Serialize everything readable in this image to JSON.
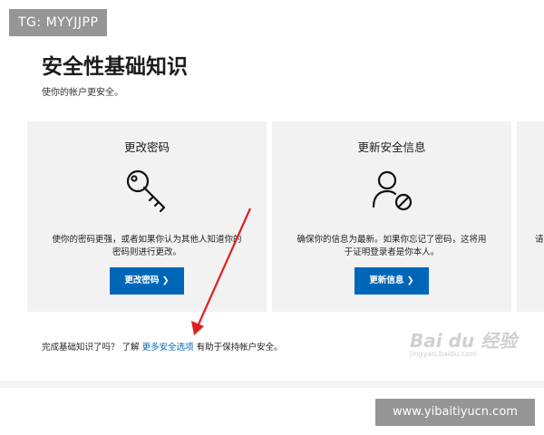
{
  "overlay": {
    "tg_label": "TG: MYYJJPP",
    "site_badge": "www.yibaitiyucn.com"
  },
  "page": {
    "title": "安全性基础知识",
    "subtitle": "使你的帐户更安全。"
  },
  "cards": [
    {
      "title": "更改密码",
      "icon": "key-icon",
      "desc_line1": "使你的密码更强，或者如果你认为其他人知道你的",
      "desc_line2": "密码则进行更改。",
      "button": "更改密码 ❯"
    },
    {
      "title": "更新安全信息",
      "icon": "user-block-icon",
      "desc_line1": "确保你的信息为最新。如果你忘记了密码，这将用",
      "desc_line2": "于证明登录者是你本人。",
      "button": "更新信息 ❯"
    },
    {
      "desc_partial": "请"
    }
  ],
  "footer": {
    "prefix": "完成基础知识了吗？ 了解",
    "link": "更多安全选项",
    "suffix": "有助于保持帐户安全。"
  },
  "watermark": {
    "logo": "Bai du 经验",
    "sub": "jingyan.baidu.com"
  },
  "colors": {
    "accent": "#0067b8",
    "card_bg": "#f2f2f2",
    "arrow": "#e02020"
  }
}
